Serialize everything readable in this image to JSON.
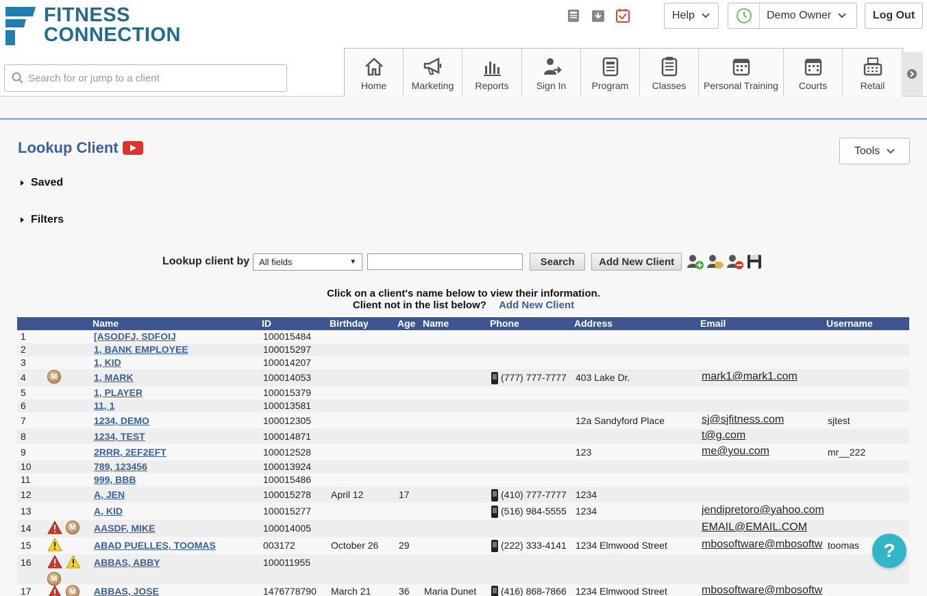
{
  "brand": {
    "line1": "FITNESS",
    "line2": "CONNECTION",
    "color": "#236b8e"
  },
  "search": {
    "placeholder": "Search for or jump to a client"
  },
  "header": {
    "help_label": "Help",
    "owner_label": "Demo Owner",
    "logout_label": "Log Out"
  },
  "nav": [
    {
      "label": "Home",
      "icon": "home-icon"
    },
    {
      "label": "Marketing",
      "icon": "megaphone-icon"
    },
    {
      "label": "Reports",
      "icon": "bar-chart-icon"
    },
    {
      "label": "Sign In",
      "icon": "sign-in-icon"
    },
    {
      "label": "Program",
      "icon": "program-icon"
    },
    {
      "label": "Classes",
      "icon": "classes-icon"
    },
    {
      "label": "Personal Training",
      "icon": "calendar-icon"
    },
    {
      "label": "Courts",
      "icon": "courts-icon"
    },
    {
      "label": "Retail",
      "icon": "register-icon"
    }
  ],
  "page": {
    "title": "Lookup Client",
    "tools_label": "Tools",
    "saved_label": "Saved",
    "filters_label": "Filters"
  },
  "lookup": {
    "label": "Lookup client by",
    "select_value": "All fields",
    "search_label": "Search",
    "add_label": "Add New Client"
  },
  "instructions": {
    "line1": "Click on a client's name below to view their information.",
    "line2": "Client not in the list below?",
    "link": "Add New Client"
  },
  "table": {
    "headers": {
      "name": "Name",
      "id": "ID",
      "birthday": "Birthday",
      "age": "Age",
      "name2": "Name",
      "phone": "Phone",
      "address": "Address",
      "email": "Email",
      "username": "Username"
    },
    "rows": [
      {
        "num": "1",
        "name": "[ASODFJ, SDFOIJ",
        "id": "100015484",
        "flags": []
      },
      {
        "num": "2",
        "name": "1, BANK EMPLOYEE",
        "id": "100015297",
        "flags": []
      },
      {
        "num": "3",
        "name": "1, KID",
        "id": "100014207",
        "flags": []
      },
      {
        "num": "4",
        "name": "1, MARK",
        "id": "100014053",
        "flags": [
          "M"
        ],
        "phone": "(777) 777-7777",
        "address": "403 Lake Dr.",
        "email": "mark1@mark1.com"
      },
      {
        "num": "5",
        "name": "1, PLAYER",
        "id": "100015379",
        "flags": []
      },
      {
        "num": "6",
        "name": "11, 1",
        "id": "100013581",
        "flags": []
      },
      {
        "num": "7",
        "name": "1234, DEMO",
        "id": "100012305",
        "flags": [],
        "address": "12a Sandyford Place",
        "email": "sj@sjfitness.com",
        "username": "sjtest"
      },
      {
        "num": "8",
        "name": "1234, TEST",
        "id": "100014871",
        "flags": [],
        "email": "t@g.com"
      },
      {
        "num": "9",
        "name": "2RRR, 2EF2EFT",
        "id": "100012528",
        "flags": [],
        "address": "123",
        "email": "me@you.com",
        "username": "mr__222"
      },
      {
        "num": "10",
        "name": "789, 123456",
        "id": "100013924",
        "flags": []
      },
      {
        "num": "11",
        "name": "999, BBB",
        "id": "100015486",
        "flags": []
      },
      {
        "num": "12",
        "name": "A, JEN",
        "id": "100015278",
        "birthday": "April 12",
        "age": "17",
        "flags": [],
        "phone": "(410) 777-7777",
        "address": "1234"
      },
      {
        "num": "13",
        "name": "A, KID",
        "id": "100015277",
        "flags": [],
        "phone": "(516) 984-5555",
        "address": "1234",
        "email": "jendipretoro@yahoo.com"
      },
      {
        "num": "14",
        "name": "AASDF, MIKE",
        "id": "100014005",
        "flags": [
          "alert-red",
          "M"
        ],
        "email": "EMAIL@EMAIL.COM"
      },
      {
        "num": "15",
        "name": "ABAD PUELLES, TOOMAS",
        "id": "003172",
        "birthday": "October 26",
        "age": "29",
        "flags": [
          "alert-yellow"
        ],
        "phone": "(222) 333-4141",
        "address": "1234 Elmwood Street",
        "email": "mbosoftware@mbosoftw",
        "username": "toomas"
      },
      {
        "num": "16",
        "name": "ABBAS, ABBY",
        "id": "100011955",
        "flags": [
          "alert-red",
          "alert-yellow",
          "M"
        ]
      },
      {
        "num": "17",
        "name": "ABBAS, JOSE",
        "id": "1476778790",
        "birthday": "March 21",
        "age": "36",
        "name2": "Maria Dunet",
        "phone": "(416) 868-7866",
        "address": "1234 Elmwood Street",
        "email": "mbosoftware@mbosoftw",
        "flags": [
          "alert-red",
          "M"
        ]
      }
    ]
  },
  "help_fab": "?"
}
